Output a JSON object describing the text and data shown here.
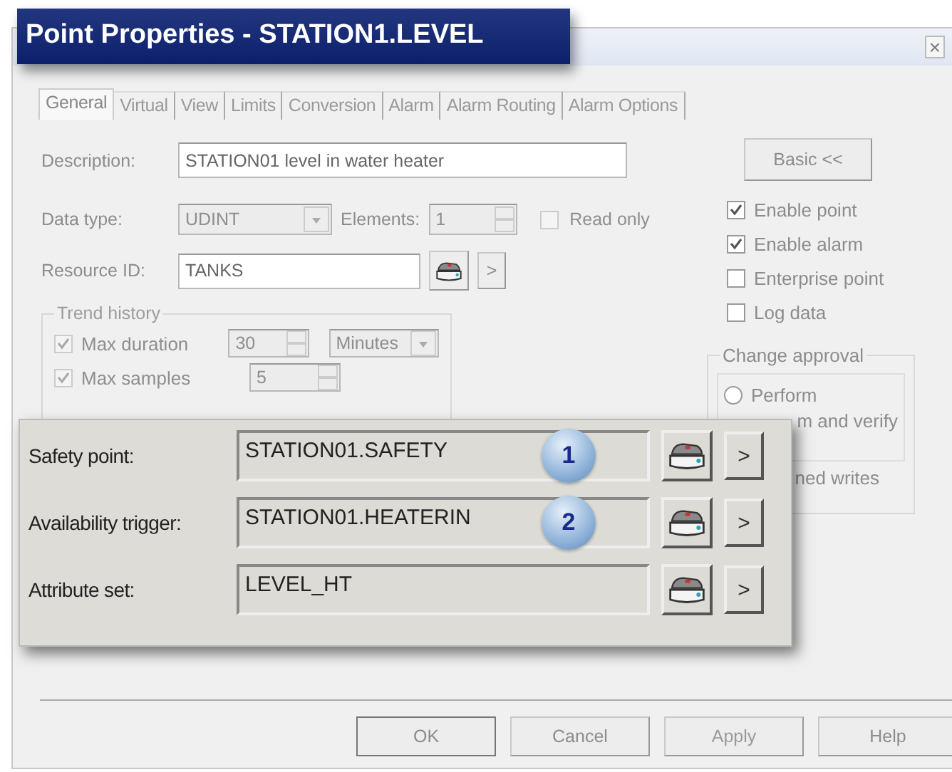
{
  "title_overlay": "Point Properties - STATION1.LEVEL",
  "dialog": {
    "close": "×",
    "tabs": [
      {
        "label": "General",
        "selected": true
      },
      {
        "label": "Virtual",
        "selected": false
      },
      {
        "label": "View",
        "selected": false
      },
      {
        "label": "Limits",
        "selected": false
      },
      {
        "label": "Conversion",
        "selected": false
      },
      {
        "label": "Alarm",
        "selected": false
      },
      {
        "label": "Alarm Routing",
        "selected": false
      },
      {
        "label": "Alarm Options",
        "selected": false
      }
    ],
    "description": {
      "label": "Description:",
      "value": "STATION01 level in water heater"
    },
    "data_type": {
      "label": "Data type:",
      "value": "UDINT",
      "disabled": true
    },
    "elements": {
      "label": "Elements:",
      "value": "1",
      "disabled": true
    },
    "read_only": {
      "label": "Read only",
      "checked": false,
      "disabled": true
    },
    "resource_id": {
      "label": "Resource ID:",
      "value": "TANKS",
      "browse": ">"
    },
    "trend_history": {
      "title": "Trend history",
      "disabled": true,
      "rows": [
        {
          "label": "Max duration",
          "checked": true,
          "value": "30",
          "unit": "Minutes"
        },
        {
          "label": "Max samples",
          "checked": true,
          "value": "5"
        }
      ]
    },
    "basic_button": "Basic <<",
    "options": [
      {
        "label": "Enable point",
        "checked": true
      },
      {
        "label": "Enable alarm",
        "checked": true
      },
      {
        "label": "Enterprise point",
        "checked": false
      },
      {
        "label": "Log data",
        "checked": false
      }
    ],
    "change_approval": {
      "title": "Change approval",
      "options": [
        {
          "label": "Perform",
          "selected": false
        }
      ],
      "covered_option": "m and verify",
      "covered_note": "ned writes"
    },
    "buttons": [
      {
        "label": "OK",
        "disabled": false,
        "default": true
      },
      {
        "label": "Cancel",
        "disabled": false,
        "default": false
      },
      {
        "label": "Apply",
        "disabled": true,
        "default": false
      },
      {
        "label": "Help",
        "disabled": false,
        "default": false
      }
    ]
  },
  "callout": {
    "rows": [
      {
        "label": "Safety point:",
        "value": "STATION01.SAFETY",
        "badge": "1",
        "browse": ">"
      },
      {
        "label": "Availability trigger:",
        "value": "STATION01.HEATERIN",
        "badge": "2",
        "browse": ">"
      },
      {
        "label": "Attribute set:",
        "value": "LEVEL_HT",
        "browse": ">"
      }
    ]
  }
}
